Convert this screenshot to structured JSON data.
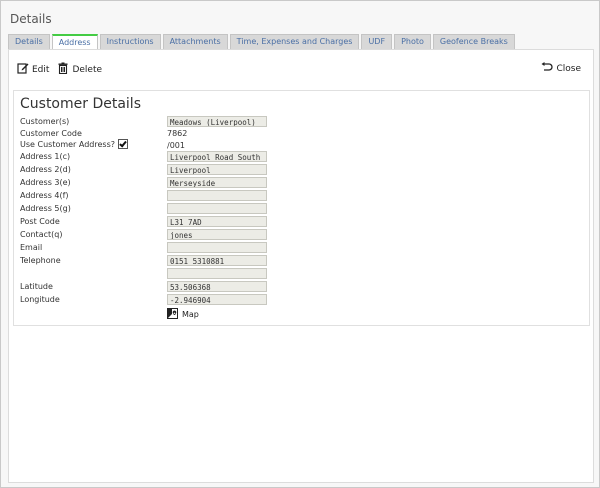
{
  "window": {
    "title": "Details"
  },
  "tabs": [
    {
      "label": "Details",
      "active": false
    },
    {
      "label": "Address",
      "active": true
    },
    {
      "label": "Instructions",
      "active": false
    },
    {
      "label": "Attachments",
      "active": false
    },
    {
      "label": "Time, Expenses and Charges",
      "active": false
    },
    {
      "label": "UDF",
      "active": false
    },
    {
      "label": "Photo",
      "active": false
    },
    {
      "label": "Geofence Breaks",
      "active": false
    }
  ],
  "toolbar": {
    "edit": "Edit",
    "delete": "Delete",
    "close": "Close"
  },
  "customer": {
    "heading": "Customer Details",
    "rows": {
      "customer_label": "Customer(s)",
      "customer_value": "Meadows (Liverpool)",
      "code_label": "Customer Code",
      "code_value": "7862 /001",
      "use_addr_label": "Use Customer Address?",
      "addr1_label": "Address 1(c)",
      "addr1_value": "Liverpool Road South",
      "addr2_label": "Address 2(d)",
      "addr2_value": "Liverpool",
      "addr3_label": "Address 3(e)",
      "addr3_value": "Merseyside",
      "addr4_label": "Address 4(f)",
      "addr4_value": "",
      "addr5_label": "Address 5(g)",
      "addr5_value": "",
      "postcode_label": "Post Code",
      "postcode_value": "L31 7AD",
      "contact_label": "Contact(q)",
      "contact_value": "jones",
      "email_label": "Email",
      "email_value": "",
      "telephone_label": "Telephone",
      "telephone_value": "0151 5310881",
      "extra_value": "",
      "lat_label": "Latitude",
      "lat_value": "53.506368",
      "lon_label": "Longitude",
      "lon_value": "-2.946904"
    },
    "use_customer_address": true,
    "map_label": "Map"
  },
  "colors": {
    "active_tab_accent": "#44cc44",
    "tab_text": "#4a6fa5",
    "field_bg": "#ecece6"
  },
  "icons": [
    "edit-icon",
    "delete-icon",
    "undo-icon",
    "map-icon"
  ]
}
